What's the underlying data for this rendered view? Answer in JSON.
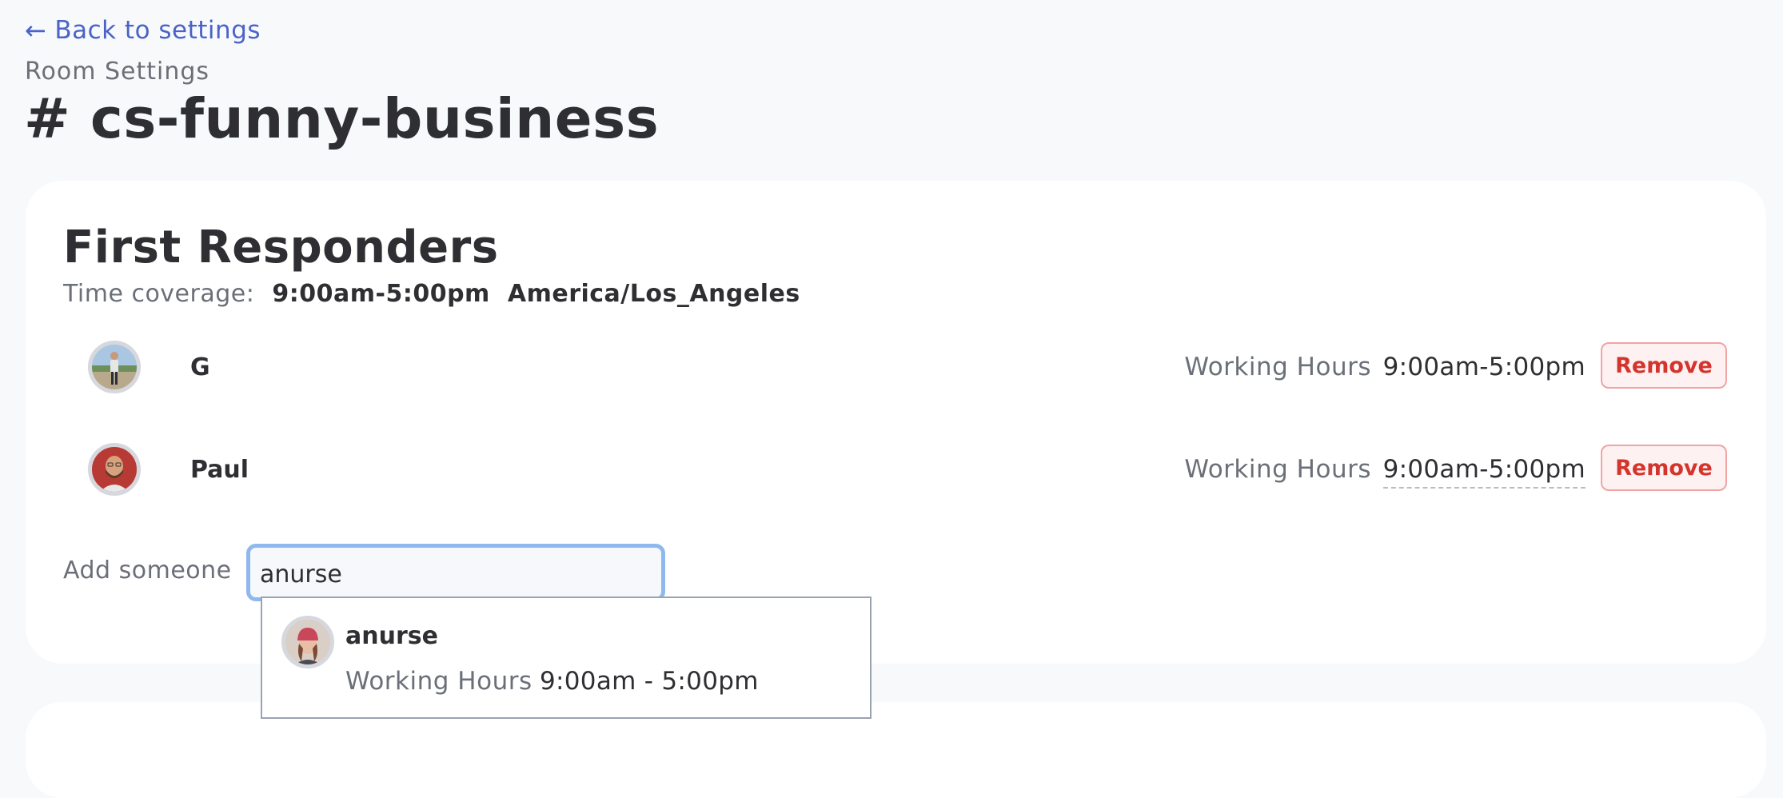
{
  "nav": {
    "back_arrow": "←",
    "back_label": "Back to settings"
  },
  "header": {
    "eyebrow": "Room Settings",
    "room_title": "# cs-funny-business"
  },
  "first_responders": {
    "title": "First Responders",
    "coverage_label": "Time coverage:",
    "coverage_hours": "9:00am-5:00pm",
    "coverage_timezone": "America/Los_Angeles",
    "responders": [
      {
        "name": "G",
        "hours_label": "Working Hours",
        "hours_value": "9:00am-5:00pm",
        "remove_label": "Remove",
        "avatar": "person-standing-outdoors-avatar"
      },
      {
        "name": "Paul",
        "hours_label": "Working Hours",
        "hours_value": "9:00am-5:00pm",
        "remove_label": "Remove",
        "avatar": "bearded-man-avatar"
      }
    ],
    "add_label": "Add someone",
    "add_input_value": "anurse",
    "suggestion": {
      "name": "anurse",
      "hours_label": "Working Hours",
      "hours_value": "9:00am - 5:00pm",
      "avatar": "woman-red-beanie-avatar"
    }
  },
  "colors": {
    "link": "#4a63c8",
    "remove_text": "#d5342d",
    "remove_border": "#f2a3a3",
    "input_focus": "#8fb8ee",
    "page_bg": "#f8f9fb"
  }
}
